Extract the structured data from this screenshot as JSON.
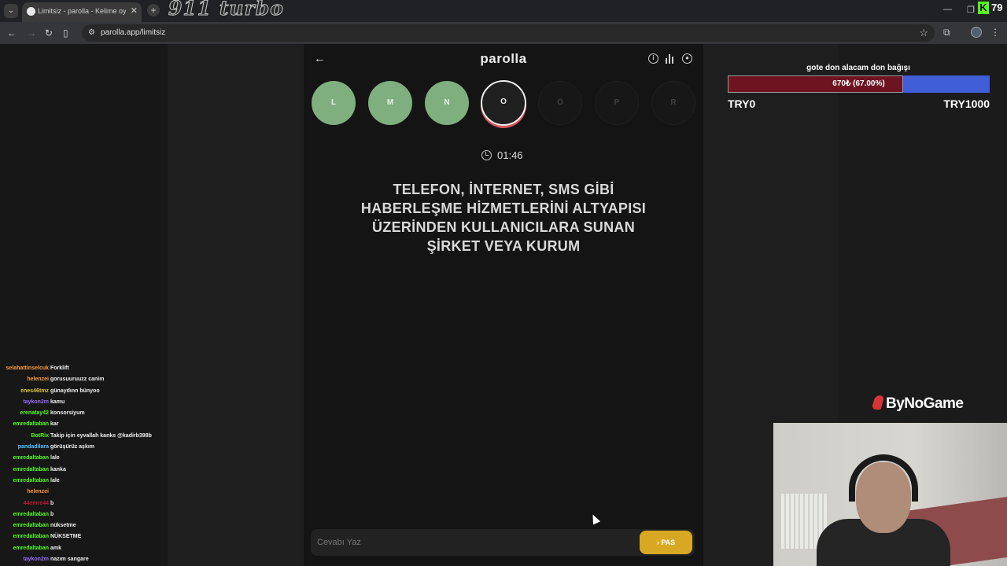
{
  "browser": {
    "tab_title": "Limitsiz - parolla - Kelime oyunu",
    "url": "parolla.app/limitsiz",
    "header_logo": "911 turbo",
    "kick_count": "79"
  },
  "game": {
    "brand": "parolla",
    "letters": [
      {
        "char": "L",
        "state": "done"
      },
      {
        "char": "M",
        "state": "done"
      },
      {
        "char": "N",
        "state": "done"
      },
      {
        "char": "O",
        "state": "active"
      },
      {
        "char": "Ö",
        "state": "pending"
      },
      {
        "char": "P",
        "state": "pending"
      },
      {
        "char": "R",
        "state": "pending"
      }
    ],
    "timer": "01:46",
    "question": "TELEFON, İNTERNET, SMS GİBİ HABERLEŞME HİZMETLERİNİ ALTYAPISI ÜZERİNDEN KULLANICILARA SUNAN ŞİRKET VEYA KURUM",
    "answer_placeholder": "Cevabı Yaz",
    "pass_label": "PAS"
  },
  "donation": {
    "title": "gote don alacam don bağışı",
    "progress_text": "670₺ (67.00%)",
    "progress_fraction": 0.67,
    "min_label": "TRY0",
    "max_label": "TRY1000"
  },
  "sponsor": "ByNoGame",
  "chat": [
    {
      "user": "selahattinselcuk",
      "text": "Forklift",
      "color": "#ff9b3d"
    },
    {
      "user": "helenzei",
      "text": "gorusuuruuzz canim",
      "color": "#ff9b3d"
    },
    {
      "user": "enes46tmz",
      "text": "günaydınn bünyoo",
      "color": "#e0c43a"
    },
    {
      "user": "taykon2m",
      "text": "kamu",
      "color": "#9a6cff"
    },
    {
      "user": "erenatay42",
      "text": "konsorsiyum",
      "color": "#53fc18"
    },
    {
      "user": "emredaltaban",
      "text": "kar",
      "color": "#53fc18"
    },
    {
      "user": "BotRix",
      "text": "Takip için eyvallah kanks @kadirb398b",
      "color": "#53fc18"
    },
    {
      "user": "pandadilara",
      "text": "görüşürüz aşkım",
      "color": "#4fc3ff"
    },
    {
      "user": "emredaltaban",
      "text": "lale",
      "color": "#53fc18"
    },
    {
      "user": "emredaltaban",
      "text": "kanka",
      "color": "#53fc18"
    },
    {
      "user": "emredaltaban",
      "text": "lale",
      "color": "#53fc18"
    },
    {
      "user": "helenzei",
      "text": "",
      "color": "#ff9b3d"
    },
    {
      "user": "44emre44",
      "text": "b",
      "color": "#c0153a"
    },
    {
      "user": "emredaltaban",
      "text": "b",
      "color": "#53fc18"
    },
    {
      "user": "emredaltaban",
      "text": "nüksetme",
      "color": "#53fc18"
    },
    {
      "user": "emredaltaban",
      "text": "NÜKSETME",
      "color": "#53fc18"
    },
    {
      "user": "emredaltaban",
      "text": "amk",
      "color": "#53fc18"
    },
    {
      "user": "taykon2m",
      "text": "nazım sangare",
      "color": "#9a6cff"
    }
  ]
}
